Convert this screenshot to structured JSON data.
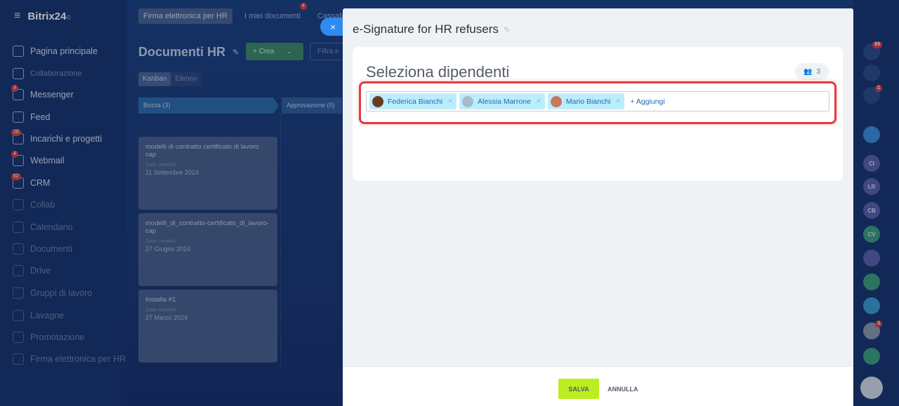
{
  "app": {
    "logo": "Bitrix24",
    "logo_mark": "©"
  },
  "sidebar": {
    "items": [
      {
        "label": "Pagina principale",
        "icon": "home-icon",
        "badge": ""
      },
      {
        "label": "Collaborazione",
        "icon": "collab-icon",
        "badge": ""
      },
      {
        "label": "Messenger",
        "icon": "messenger-icon",
        "badge": "3"
      },
      {
        "label": "Feed",
        "icon": "feed-icon",
        "badge": ""
      },
      {
        "label": "Incarichi e progetti",
        "icon": "tasks-icon",
        "badge": "18"
      },
      {
        "label": "Webmail",
        "icon": "mail-icon",
        "badge": "4"
      },
      {
        "label": "CRM",
        "icon": "crm-icon",
        "badge": "62"
      },
      {
        "label": "Collab",
        "icon": "collab-circle-icon",
        "badge": ""
      },
      {
        "label": "Calendario",
        "icon": "calendar-icon",
        "badge": ""
      },
      {
        "label": "Documenti",
        "icon": "documents-icon",
        "badge": ""
      },
      {
        "label": "Drive",
        "icon": "drive-icon",
        "badge": ""
      },
      {
        "label": "Gruppi di lavoro",
        "icon": "groups-icon",
        "badge": ""
      },
      {
        "label": "Lavagne",
        "icon": "boards-icon",
        "badge": ""
      },
      {
        "label": "Promotazione",
        "icon": "promo-icon",
        "badge": ""
      },
      {
        "label": "Firma elettronica per HR",
        "icon": "signature-icon",
        "badge": ""
      }
    ]
  },
  "board": {
    "tabs": [
      {
        "label": "Firma elettronica per HR",
        "badge": ""
      },
      {
        "label": "I miei documenti",
        "badge": "4"
      },
      {
        "label": "Cassafor",
        "badge": ""
      }
    ],
    "title": "Documenti HR",
    "create_label": "+ Crea",
    "filter_placeholder": "Filtra e",
    "views": [
      "Kanban",
      "Elenco"
    ],
    "columns": [
      {
        "label": "Bozza (3)"
      },
      {
        "label": "Approvazione (0)"
      }
    ],
    "cards": [
      {
        "title": "modelli di contratto certificato di lavoro cap",
        "date_label": "Date created",
        "date": "11 Settembre 2024"
      },
      {
        "title": "modelli_di_contratto-certificato_di_lavoro-cap",
        "date_label": "Date created",
        "date": "27 Giugno 2024"
      },
      {
        "title": "Installa #1",
        "date_label": "Date created",
        "date": "27 Marzo 2024"
      }
    ]
  },
  "rail": {
    "items": [
      {
        "label": "",
        "icon": "bell-icon",
        "badge": "69",
        "color": "#2b4a86"
      },
      {
        "label": "",
        "icon": "target-icon",
        "badge": "",
        "color": "#2b4a86"
      },
      {
        "label": "",
        "icon": "chat-icon",
        "badge": "1",
        "color": "#2b4a86"
      },
      {
        "label": "",
        "icon": "bookmark-icon",
        "badge": "",
        "color": "#3a8fd9"
      },
      {
        "label": "CI",
        "icon": "",
        "badge": "",
        "color": "#5a5fa8"
      },
      {
        "label": "LR",
        "icon": "",
        "badge": "",
        "color": "#5a5fa8"
      },
      {
        "label": "CB",
        "icon": "",
        "badge": "",
        "color": "#5a5fa8"
      },
      {
        "label": "CV",
        "icon": "",
        "badge": "",
        "color": "#3aa07a"
      },
      {
        "label": "",
        "icon": "people-icon",
        "badge": "",
        "color": "#5a5fa8"
      },
      {
        "label": "",
        "icon": "contact-card-icon",
        "badge": "",
        "color": "#3aa07a"
      },
      {
        "label": "",
        "icon": "message-icon",
        "badge": "",
        "color": "#3a9bd0"
      },
      {
        "label": "",
        "icon": "avatar-icon",
        "badge": "3",
        "color": "#8c9aa8"
      },
      {
        "label": "",
        "icon": "checkbox-icon",
        "badge": "",
        "color": "#3aa07a"
      },
      {
        "label": "",
        "icon": "menu-icon",
        "badge": "",
        "color": "#d7dde6"
      }
    ]
  },
  "panel": {
    "close_glyph": "×",
    "title": "e-Signature for HR refusers",
    "card_heading": "Seleziona dipendenti",
    "count": "3",
    "employees": [
      {
        "name": "Federica Bianchi",
        "avatar_color": "#6b3a24"
      },
      {
        "name": "Alessia Marrone",
        "avatar_color": "#a9b9cc"
      },
      {
        "name": "Mario Bianchi",
        "avatar_color": "#c8785a"
      }
    ],
    "add_label": "+ Aggiungi",
    "save_label": "SALVA",
    "cancel_label": "ANNULLA"
  }
}
